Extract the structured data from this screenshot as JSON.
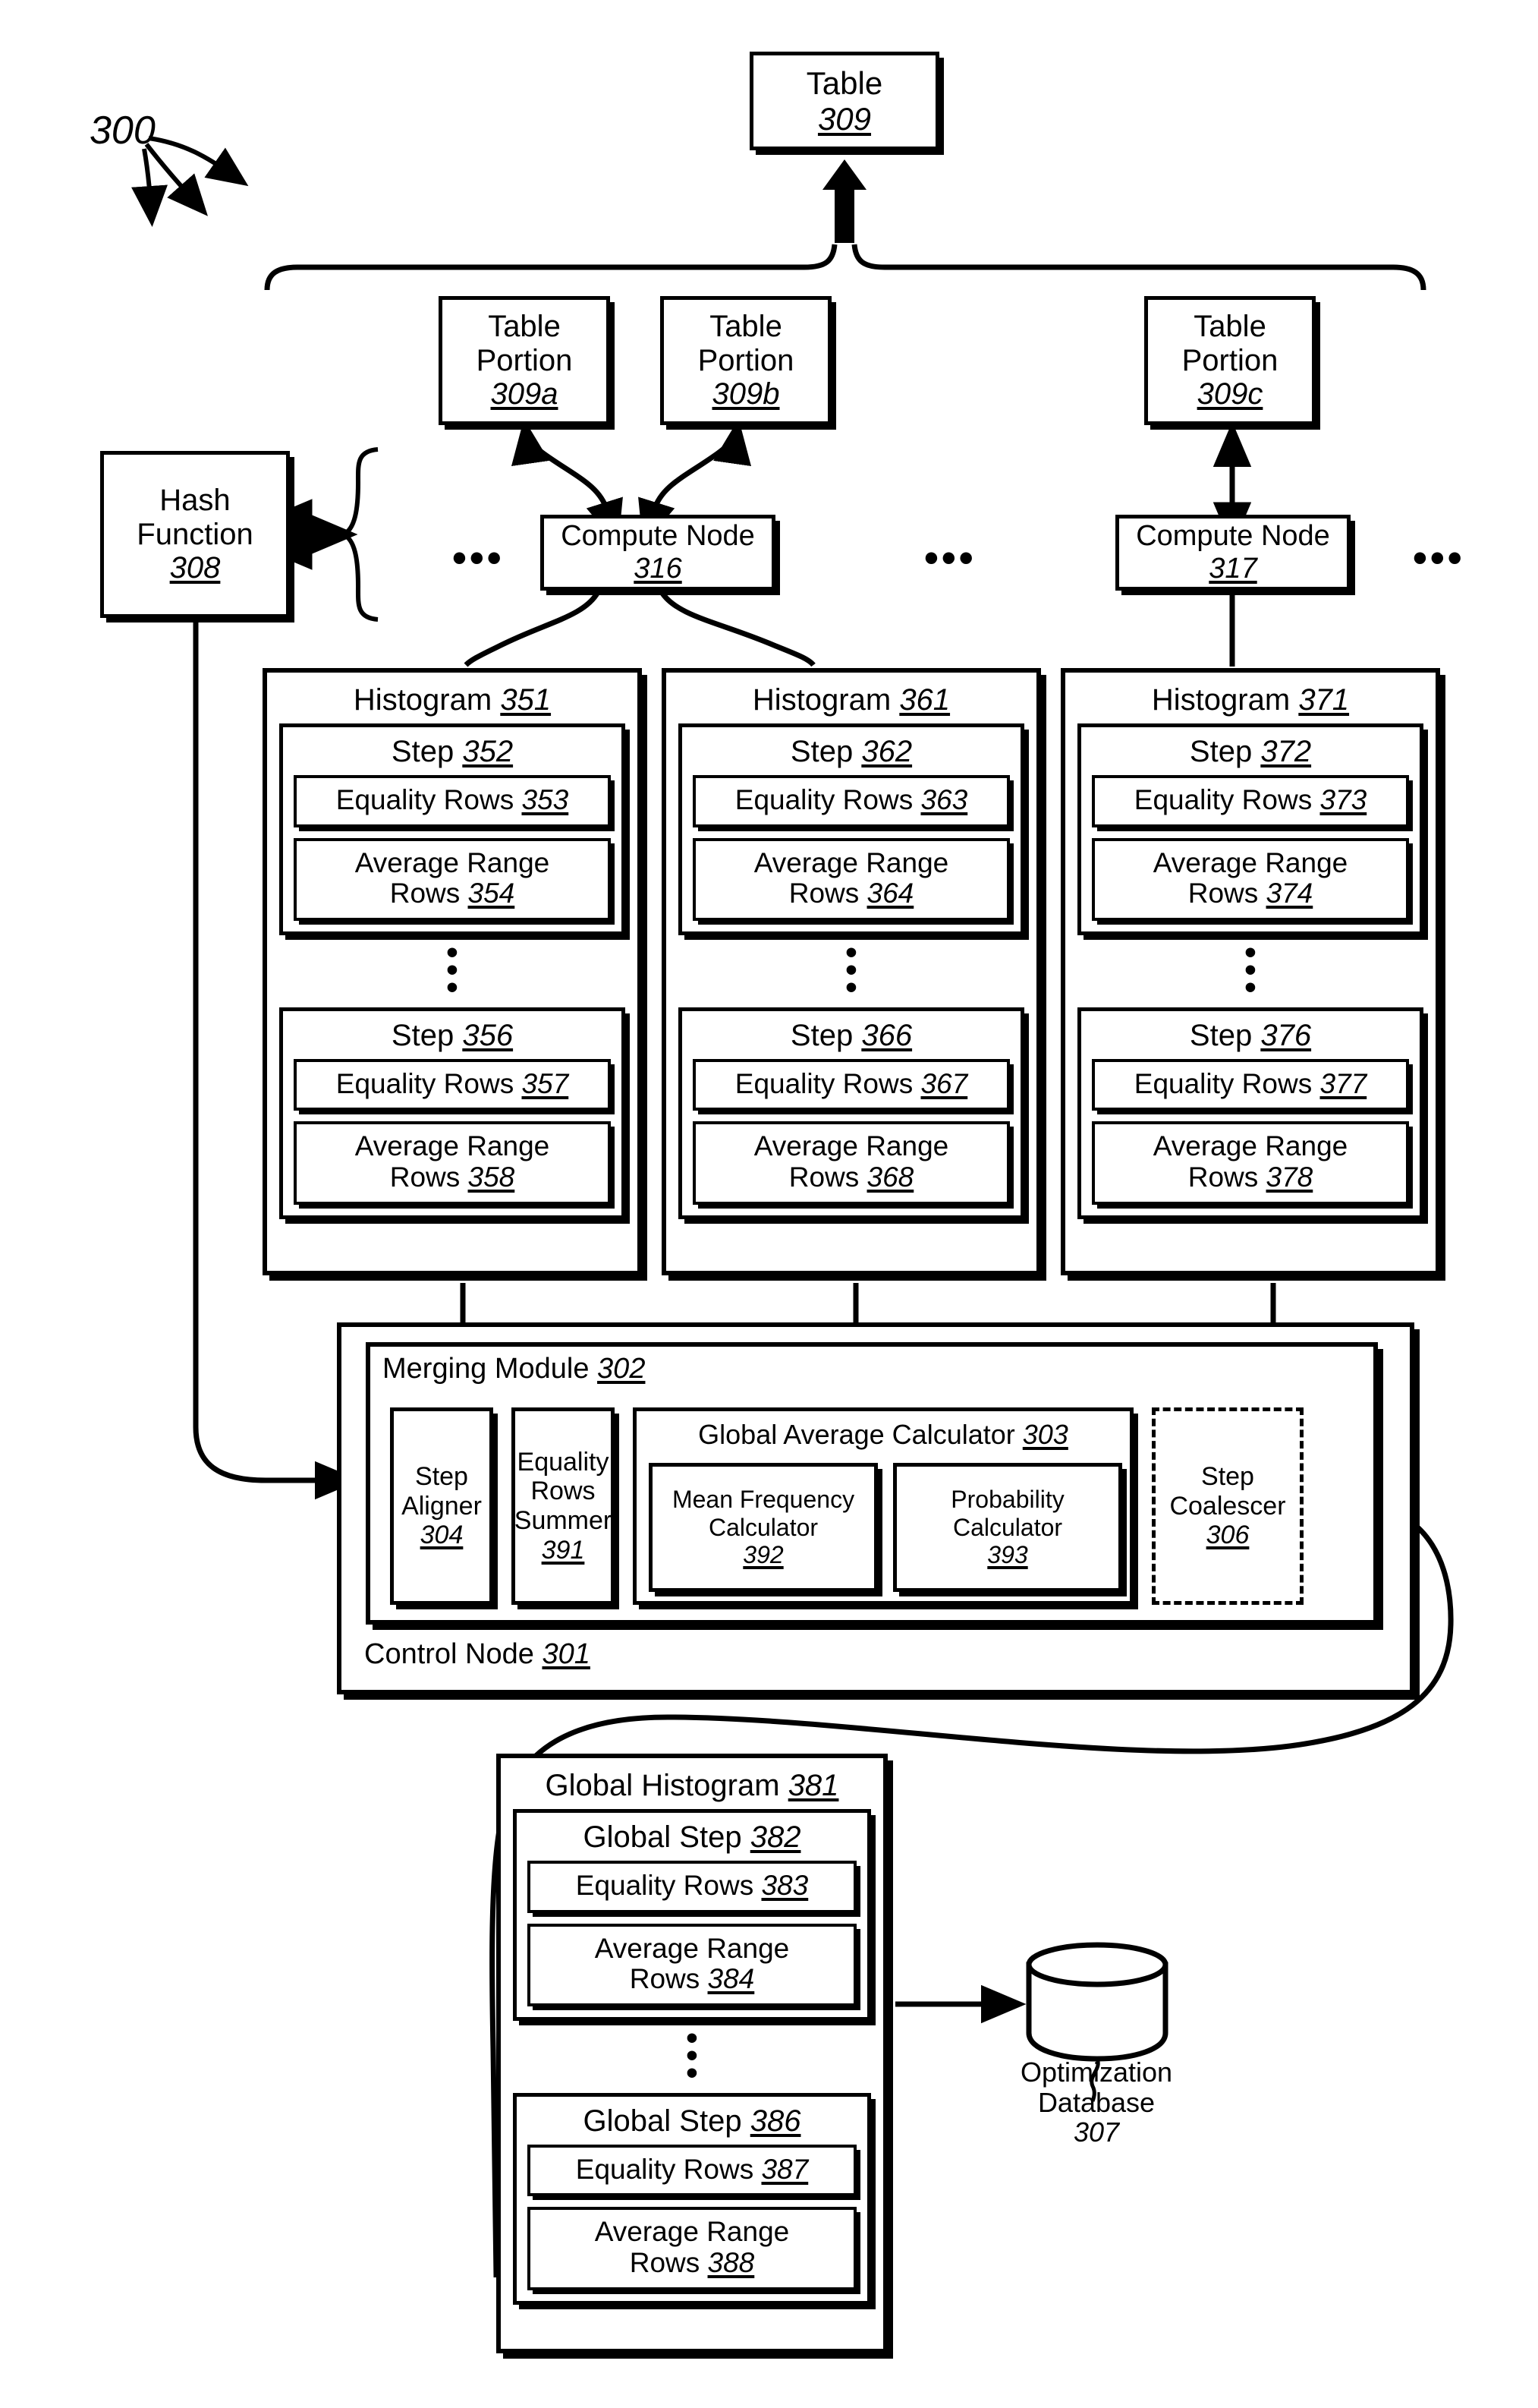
{
  "figure": {
    "number": "300"
  },
  "table": {
    "name": "Table",
    "ref": "309"
  },
  "table_portions": [
    {
      "name_line1": "Table",
      "name_line2": "Portion",
      "ref": "309a"
    },
    {
      "name_line1": "Table",
      "name_line2": "Portion",
      "ref": "309b"
    },
    {
      "name_line1": "Table",
      "name_line2": "Portion",
      "ref": "309c"
    }
  ],
  "hash_function": {
    "line1": "Hash",
    "line2": "Function",
    "ref": "308"
  },
  "compute_nodes": [
    {
      "name": "Compute Node",
      "ref": "316"
    },
    {
      "name": "Compute Node",
      "ref": "317"
    }
  ],
  "ellipsis": "•••",
  "vertical_dots": "•",
  "histograms": [
    {
      "title": "Histogram",
      "ref": "351",
      "steps": [
        {
          "title": "Step",
          "ref": "352",
          "equality": {
            "label": "Equality Rows",
            "ref": "353"
          },
          "average": {
            "label_line1": "Average Range",
            "label_line2": "Rows",
            "ref": "354"
          }
        },
        {
          "title": "Step",
          "ref": "356",
          "equality": {
            "label": "Equality Rows",
            "ref": "357"
          },
          "average": {
            "label_line1": "Average Range",
            "label_line2": "Rows",
            "ref": "358"
          }
        }
      ]
    },
    {
      "title": "Histogram",
      "ref": "361",
      "steps": [
        {
          "title": "Step",
          "ref": "362",
          "equality": {
            "label": "Equality Rows",
            "ref": "363"
          },
          "average": {
            "label_line1": "Average Range",
            "label_line2": "Rows",
            "ref": "364"
          }
        },
        {
          "title": "Step",
          "ref": "366",
          "equality": {
            "label": "Equality Rows",
            "ref": "367"
          },
          "average": {
            "label_line1": "Average Range",
            "label_line2": "Rows",
            "ref": "368"
          }
        }
      ]
    },
    {
      "title": "Histogram",
      "ref": "371",
      "steps": [
        {
          "title": "Step",
          "ref": "372",
          "equality": {
            "label": "Equality Rows",
            "ref": "373"
          },
          "average": {
            "label_line1": "Average Range",
            "label_line2": "Rows",
            "ref": "374"
          }
        },
        {
          "title": "Step",
          "ref": "376",
          "equality": {
            "label": "Equality Rows",
            "ref": "377"
          },
          "average": {
            "label_line1": "Average Range",
            "label_line2": "Rows",
            "ref": "378"
          }
        }
      ]
    }
  ],
  "control_node": {
    "title": "Control Node",
    "ref": "301",
    "merging_module": {
      "title": "Merging Module",
      "ref": "302",
      "step_aligner": {
        "line1": "Step",
        "line2": "Aligner",
        "ref": "304"
      },
      "equality_rows_summer": {
        "line1": "Equality",
        "line2": "Rows",
        "line3": "Summer",
        "ref": "391"
      },
      "global_average_calculator": {
        "title": "Global Average Calculator",
        "ref": "303",
        "mean_frequency_calculator": {
          "line1": "Mean Frequency",
          "line2": "Calculator",
          "ref": "392"
        },
        "probability_calculator": {
          "line1": "Probability",
          "line2": "Calculator",
          "ref": "393"
        }
      },
      "step_coalescer": {
        "line1": "Step",
        "line2": "Coalescer",
        "ref": "306"
      }
    }
  },
  "global_histogram": {
    "title": "Global Histogram",
    "ref": "381",
    "steps": [
      {
        "title": "Global Step",
        "ref": "382",
        "equality": {
          "label": "Equality Rows",
          "ref": "383"
        },
        "average": {
          "label_line1": "Average Range",
          "label_line2": "Rows",
          "ref": "384"
        }
      },
      {
        "title": "Global Step",
        "ref": "386",
        "equality": {
          "label": "Equality Rows",
          "ref": "387"
        },
        "average": {
          "label_line1": "Average Range",
          "label_line2": "Rows",
          "ref": "388"
        }
      }
    ]
  },
  "optimization_database": {
    "line1": "Optimization",
    "line2": "Database",
    "ref": "307"
  },
  "colors": {
    "ink": "#000000",
    "paper": "#ffffff"
  }
}
